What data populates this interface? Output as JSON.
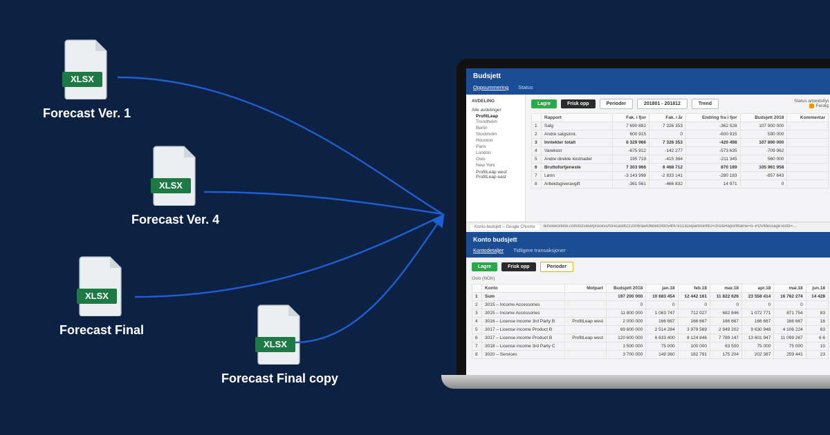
{
  "files": [
    {
      "label": "Forecast Ver. 1",
      "badge": "XLSX"
    },
    {
      "label": "Forecast Ver. 4",
      "badge": "XLSX"
    },
    {
      "label": "Forecast Final",
      "badge": "XLSX"
    },
    {
      "label": "Forecast Final copy",
      "badge": "XLSX"
    }
  ],
  "app": {
    "title_top": "Budsjett",
    "tabs_top": {
      "active": "Oppsummering",
      "other": "Status"
    },
    "sidebar": {
      "heading": "AVDELING",
      "root": "Alle avdelinger",
      "group": "ProfitLeap",
      "items": [
        "Trondheim",
        "Berlin",
        "Stockholm",
        "Houston",
        "Paris",
        "London",
        "Oslo",
        "New York"
      ],
      "groups_below": [
        "ProfitLeap west",
        "ProfitLeap east"
      ]
    },
    "toolbar_top": {
      "save": "Lagre",
      "refresh": "Frisk opp",
      "periods": "Perioder",
      "range": "201801 - 201812",
      "trend": "Trend"
    },
    "status": {
      "label": "Status arbeidsflyt",
      "state": "Ferdig"
    },
    "table_top": {
      "headers": [
        "",
        "Rapport",
        "Fak. i fjor",
        "Fak. i år",
        "Endring fra i fjor",
        "Budsjett 2018",
        "Kommentar"
      ],
      "rows": [
        [
          "1",
          "Salg",
          "7 690 881",
          "7 326 353",
          "-362 528",
          "107 900 000",
          ""
        ],
        [
          "2",
          "Andre salgsinnt.",
          "600 915",
          "0",
          "-600 915",
          "590 000",
          ""
        ],
        [
          "3",
          "Inntekter totalt",
          "6 329 966",
          "7 326 353",
          "-420 498",
          "107 890 000",
          ""
        ],
        [
          "4",
          "Varekost",
          "-675 912",
          "-142 277",
          "-573 635",
          "-709 962",
          ""
        ],
        [
          "5",
          "Andre direkte kostnader",
          "195 719",
          "-415 364",
          "-211 345",
          "560 000",
          ""
        ],
        [
          "6",
          "Bruttofortjeneste",
          "7 303 966",
          "6 468 712",
          "870 189",
          "105 961 958",
          ""
        ],
        [
          "7",
          "Lønn",
          "-3 143 998",
          "-2 833 141",
          "-280 183",
          "-857 643",
          ""
        ],
        [
          "8",
          "Arbeidsgiveravgift",
          "-361 561",
          "-466 832",
          "14 971",
          "0",
          ""
        ]
      ]
    },
    "chrome": {
      "tab_label": "Konto-budsjett – Google Chrome",
      "url": "bizviewonline.com/bizview/process/forecast4222006/aa436beb3fdc54f47e113DepartmentID=302&ReportName=0–PDVMessageText3=…"
    },
    "title_modal": "Konto budsjett",
    "tabs_modal": {
      "active": "Kontodetaljer",
      "other": "Tidligere transaksjoner"
    },
    "toolbar_modal": {
      "save": "Lagre",
      "refresh": "Frisk opp",
      "periods": "Perioder"
    },
    "modal_subtitle": "Oslo (NOK)",
    "table_modal": {
      "headers": [
        "",
        "Konto",
        "Motpart",
        "Budsjett 2018",
        "jan.18",
        "feb.18",
        "mar.18",
        "apr.18",
        "mai.18",
        "jun.18"
      ],
      "rows": [
        [
          "1",
          "Sum",
          "",
          "197 200 000",
          "10 683 454",
          "12 442 161",
          "11 822 626",
          "23 558 414",
          "16 762 274",
          "14 428"
        ],
        [
          "2",
          "3015 – Income Accessories",
          "",
          "0",
          "0",
          "0",
          "0",
          "0",
          "0",
          ""
        ],
        [
          "3",
          "3015 – Income Accessories",
          "",
          "11 800 000",
          "1 063 747",
          "712 027",
          "682 846",
          "1 072 771",
          "871 754",
          "83"
        ],
        [
          "4",
          "3016 – License income 3rd Party B",
          "ProfitLeap west",
          "2 000 000",
          "166 667",
          "166 667",
          "166 667",
          "166 667",
          "166 667",
          "16"
        ],
        [
          "5",
          "3017 – License income Product B",
          "",
          "69 600 000",
          "2 514 284",
          "3 979 569",
          "2 949 202",
          "9 630 948",
          "4 106 224",
          "83"
        ],
        [
          "6",
          "3017 – License income Product B",
          "ProfitLeap west",
          "120 600 000",
          "6 633 400",
          "8 124 846",
          "7 789 147",
          "13 601 947",
          "11 099 267",
          "6 6"
        ],
        [
          "7",
          "3018 – License income 3rd Party C",
          "",
          "1 500 000",
          "75 000",
          "100 000",
          "63 500",
          "75 000",
          "75 000",
          "10"
        ],
        [
          "8",
          "3020 – Services",
          "",
          "3 700 000",
          "149 360",
          "182 791",
          "175 204",
          "202 387",
          "259 441",
          "23"
        ]
      ]
    }
  }
}
